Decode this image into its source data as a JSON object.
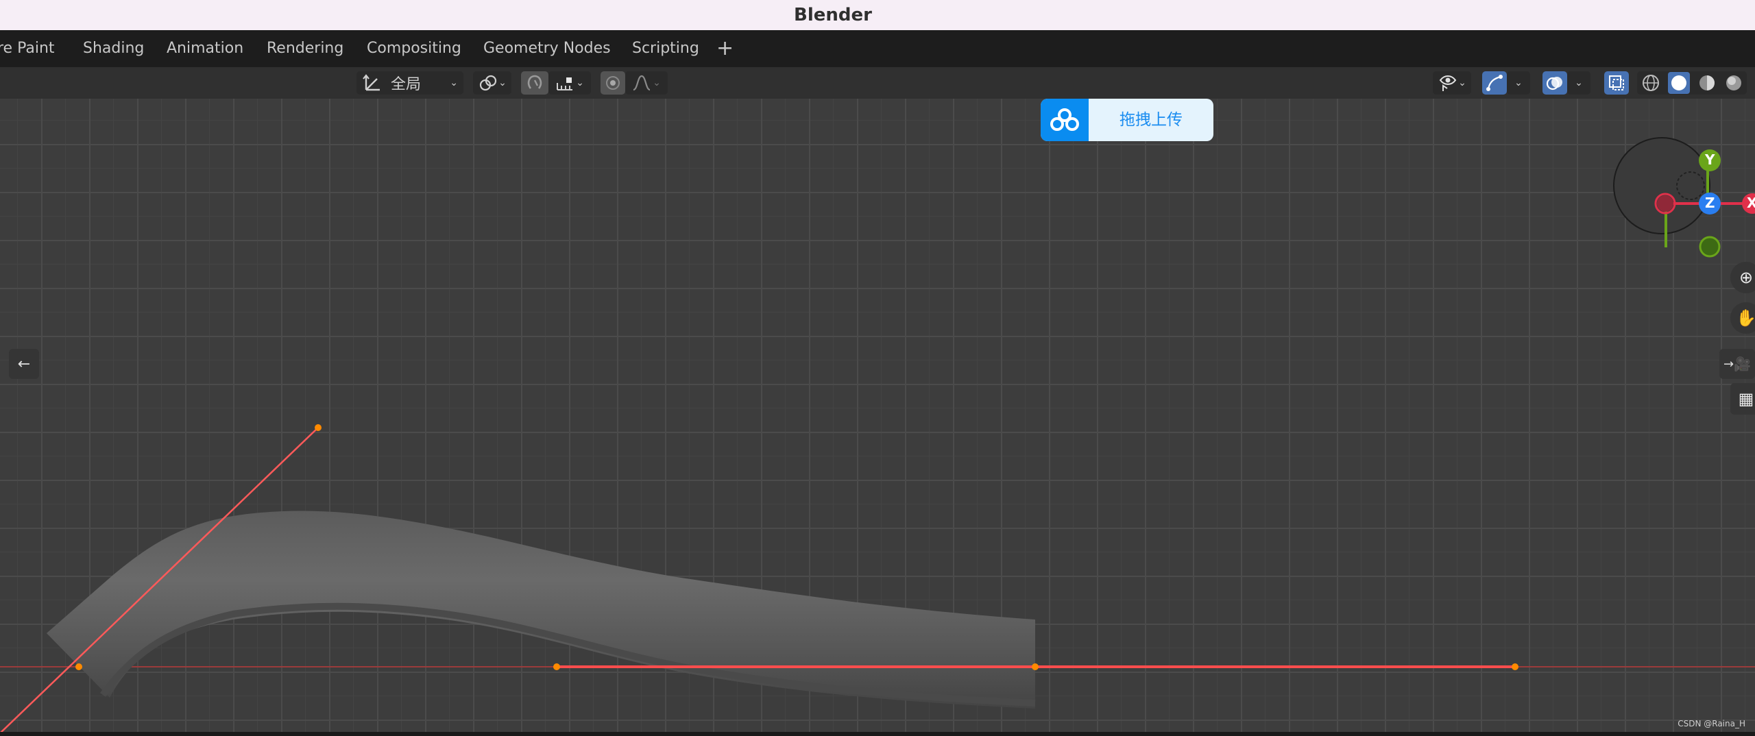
{
  "window": {
    "title": "Blender"
  },
  "tabs": [
    "re Paint",
    "Shading",
    "Animation",
    "Rendering",
    "Compositing",
    "Geometry Nodes",
    "Scripting",
    "+"
  ],
  "header": {
    "transform_orientation": "全局"
  },
  "upload_widget": {
    "label": "拖拽上传"
  },
  "gizmo": {
    "x": "X",
    "y": "Y",
    "z": "Z"
  },
  "watermark": "CSDN @Raina_H",
  "colors": {
    "title_bg": "#f6eef6",
    "tabbar_bg": "#1d1d1d",
    "viewport_bg": "#3d3d3d",
    "accent_blue": "#4772b3",
    "curve_red": "#ff4a4a",
    "vertex_orange": "#ff8a00",
    "axis_x": "#e0304a",
    "axis_y": "#6aa51a",
    "axis_z": "#2a7ef0"
  },
  "icons": [
    "transform-orientation-icon",
    "pivot-icon",
    "snap-icon",
    "snap-increment-icon",
    "proportional-edit-icon",
    "falloff-icon",
    "visibility-icon",
    "gizmo-toggle-icon",
    "overlay-icon",
    "xray-icon",
    "wireframe-shading-icon",
    "solid-shading-icon",
    "material-shading-icon",
    "rendered-shading-icon",
    "zoom-icon",
    "hand-pan-icon",
    "camera-icon",
    "grid-icon",
    "arrow-left-icon",
    "arrow-right-icon",
    "baidu-cloud-icon"
  ]
}
